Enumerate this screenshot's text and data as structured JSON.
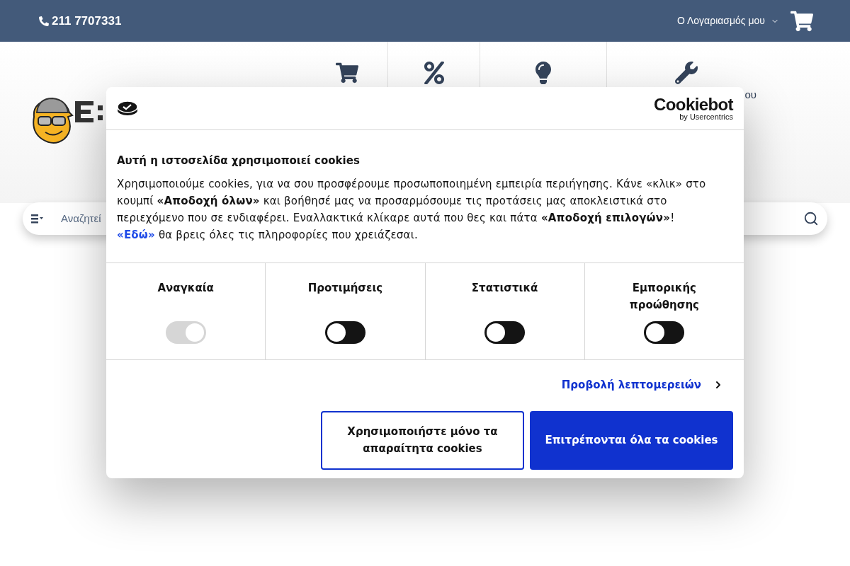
{
  "topbar": {
    "phone": "211 7707331",
    "account": "Ο Λογαριασμός μου"
  },
  "nav": [
    {
      "kind": "cart"
    },
    {
      "kind": "percent"
    },
    {
      "kind": "bulb"
    },
    {
      "kind": "wrench",
      "label": "ου"
    }
  ],
  "search": {
    "placeholder": "Αναζητεί"
  },
  "dialog": {
    "brand": "Cookiebot",
    "brand_sub": "by Usercentrics",
    "title": "Αυτή η ιστοσελίδα χρησιμοποιεί cookies",
    "body": "Χρησιμοποιούμε cookies, για να σου προσφέρουμε προσωποποιημένη εμπειρία περιήγησης. Κάνε «κλικ» στο κουμπί **«Αποδοχή όλων»** και βοήθησέ μας να προσαρμόσουμε τις προτάσεις μας αποκλειστικά στο περιεχόμενο που σε ενδιαφέρει. Εναλλακτικά κλίκαρε αυτά που θες και πάτα **«Αποδοχή επιλογών»**!",
    "link": "«Εδώ»",
    "after_link": " θα βρεις όλες τις πληροφορίες που χρειάζεσαι.",
    "categories": [
      {
        "label": "Αναγκαία",
        "checked": true,
        "disabled": true
      },
      {
        "label": "Προτιμήσεις",
        "checked": false,
        "disabled": false
      },
      {
        "label": "Στατιστικά",
        "checked": false,
        "disabled": false
      },
      {
        "label": "Εμπορικής προώθησης",
        "checked": false,
        "disabled": false
      }
    ],
    "details": "Προβολή λεπτομερειών",
    "buttons": [
      {
        "kind": "outline",
        "label": "Χρησιμοποιήστε μόνο τα απαραίτητα cookies"
      },
      {
        "kind": "primary",
        "label": "Επιτρέπονται όλα τα cookies"
      }
    ]
  }
}
